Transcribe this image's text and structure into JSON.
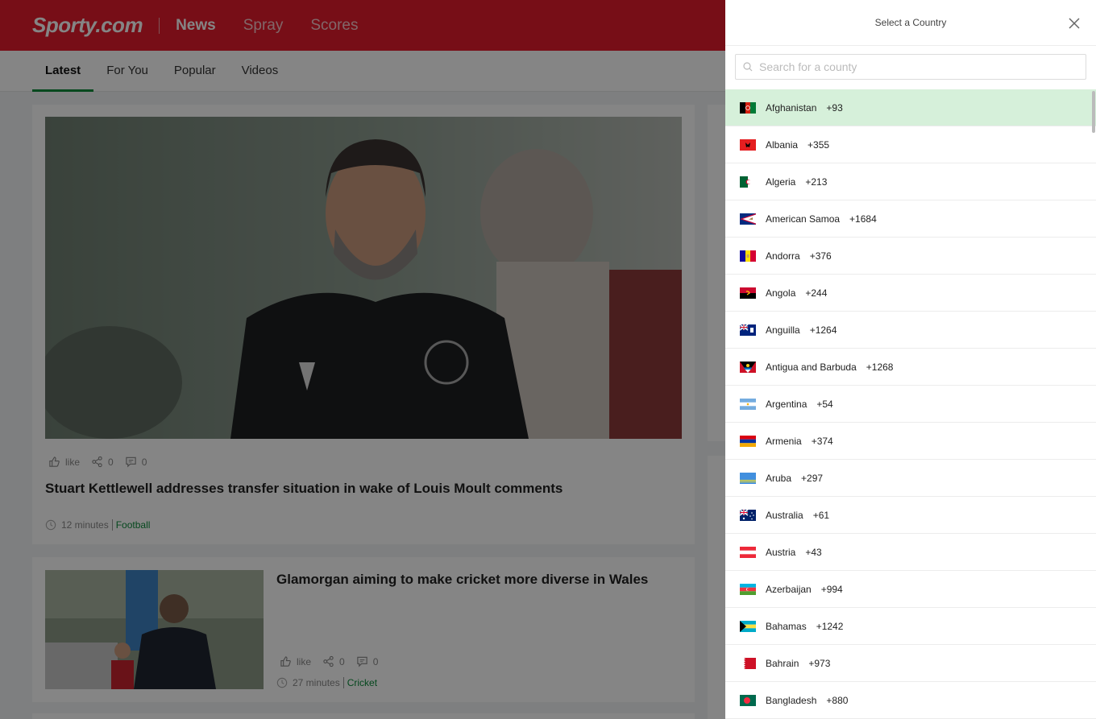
{
  "header": {
    "logo": "Sporty.com",
    "nav": [
      "News",
      "Spray",
      "Scores"
    ],
    "active_nav": "News",
    "brand_color": "#e41c2c"
  },
  "tabs": [
    "Latest",
    "For You",
    "Popular",
    "Videos"
  ],
  "articles": [
    {
      "title": "Stuart Kettlewell addresses transfer situation in wake of Louis Moult comments",
      "like_label": "like",
      "shares": "0",
      "comments": "0",
      "time": "12 minutes",
      "category": "Football"
    },
    {
      "title": "Glamorgan aiming to make cricket more diverse in Wales",
      "like_label": "like",
      "shares": "0",
      "comments": "0",
      "time": "27 minutes",
      "category": "Cricket"
    }
  ],
  "panel": {
    "title": "Select a Country",
    "search_placeholder": "Search for a county",
    "selected_color": "#d6f0da",
    "countries": [
      {
        "name": "Afghanistan",
        "code": "+93"
      },
      {
        "name": "Albania",
        "code": "+355"
      },
      {
        "name": "Algeria",
        "code": "+213"
      },
      {
        "name": "American Samoa",
        "code": "+1684"
      },
      {
        "name": "Andorra",
        "code": "+376"
      },
      {
        "name": "Angola",
        "code": "+244"
      },
      {
        "name": "Anguilla",
        "code": "+1264"
      },
      {
        "name": "Antigua and Barbuda",
        "code": "+1268"
      },
      {
        "name": "Argentina",
        "code": "+54"
      },
      {
        "name": "Armenia",
        "code": "+374"
      },
      {
        "name": "Aruba",
        "code": "+297"
      },
      {
        "name": "Australia",
        "code": "+61"
      },
      {
        "name": "Austria",
        "code": "+43"
      },
      {
        "name": "Azerbaijan",
        "code": "+994"
      },
      {
        "name": "Bahamas",
        "code": "+1242"
      },
      {
        "name": "Bahrain",
        "code": "+973"
      },
      {
        "name": "Bangladesh",
        "code": "+880"
      }
    ]
  }
}
